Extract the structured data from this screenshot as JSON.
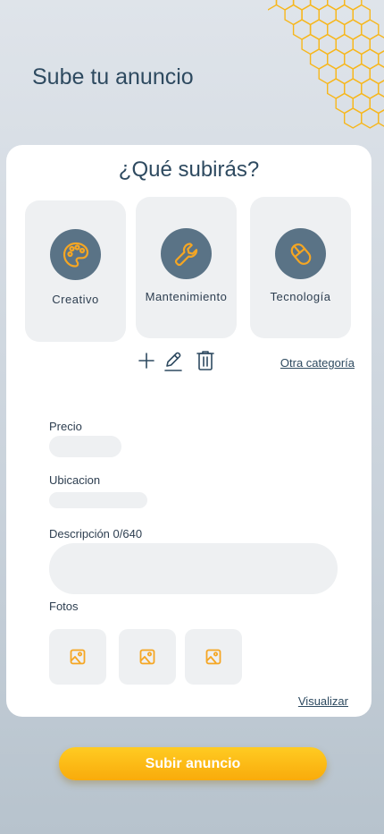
{
  "page": {
    "title": "Sube tu anuncio"
  },
  "colors": {
    "accent": "#f5a623",
    "icon_bg": "#5a7386",
    "honeycomb": "#f7b71c"
  },
  "card": {
    "title": "¿Qué subirás?",
    "categories": [
      {
        "label": "Creativo",
        "icon": "palette-icon"
      },
      {
        "label": "Mantenimiento",
        "icon": "wrench-icon"
      },
      {
        "label": "Tecnología",
        "icon": "mouse-icon"
      }
    ],
    "other_category": "Otra categoría",
    "tools": [
      "plus-icon",
      "pencil-icon",
      "trash-icon"
    ]
  },
  "form": {
    "price_label": "Precio",
    "price_value": "",
    "location_label": "Ubicacion",
    "location_value": "",
    "description_label": "Descripción 0/640",
    "description_value": "",
    "photos_label": "Fotos",
    "photos": [
      "image-icon",
      "image-icon",
      "image-icon"
    ],
    "preview_link": "Visualizar"
  },
  "submit_label": "Subir anuncio"
}
